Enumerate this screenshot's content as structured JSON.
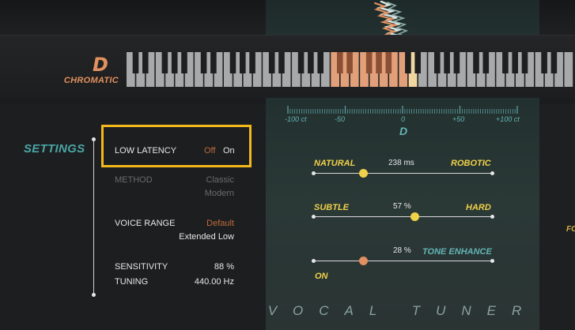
{
  "header": {
    "note": "D",
    "scale": "CHROMATIC"
  },
  "keyboard": {
    "highlighted_white_key_range": "around D",
    "active_key_color": "#f1d6a0",
    "highlight_color": "#e2a07a"
  },
  "settings": {
    "title": "SETTINGS",
    "low_latency": {
      "label": "LOW LATENCY",
      "off": "Off",
      "on": "On",
      "selected": "On"
    },
    "method": {
      "label": "METHOD",
      "option1": "Classic",
      "option2": "Modern"
    },
    "voice_range": {
      "label": "VOICE RANGE",
      "option1": "Default",
      "option2": "Extended Low"
    },
    "sensitivity": {
      "label": "SENSITIVITY",
      "value": "88 %"
    },
    "tuning": {
      "label": "TUNING",
      "value": "440.00 Hz"
    }
  },
  "tuner": {
    "cent_labels": [
      "-100 ct",
      "-50",
      "0",
      "+50",
      "+100 ct"
    ],
    "detected_note": "D"
  },
  "sliders": {
    "speed": {
      "left": "NATURAL",
      "right": "ROBOTIC",
      "value": "238 ms",
      "level": 0.28
    },
    "humanize": {
      "left": "SUBTLE",
      "right": "HARD",
      "value": "57 %",
      "level": 0.57
    },
    "formant": {
      "left_bottom": "ON",
      "right": "TONE ENHANCE",
      "value": "28 %",
      "level": 0.28
    }
  },
  "plugin_name": "VOCAL TUNER",
  "right_strip_text": "FO",
  "colors": {
    "accent_orange": "#e2905f",
    "accent_teal": "#4aa6a6",
    "accent_yellow": "#f0d14a",
    "highlight_box": "#f2b81c"
  }
}
